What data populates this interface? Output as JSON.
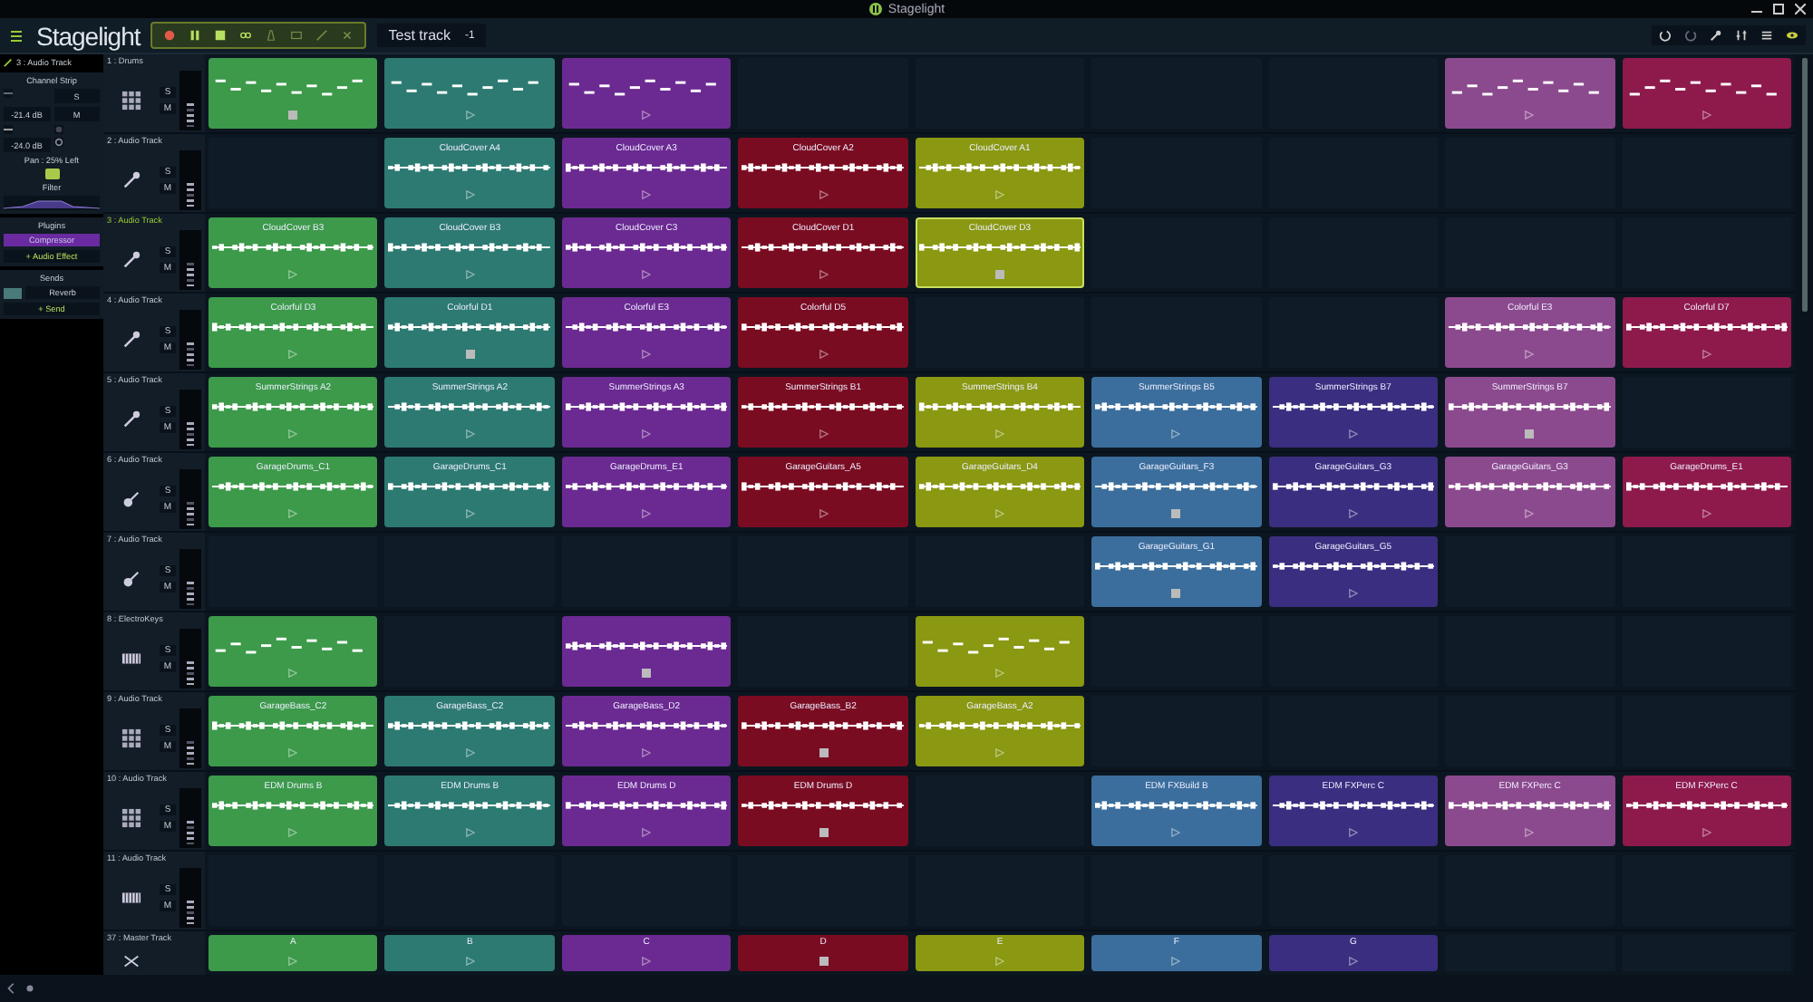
{
  "title_bar": {
    "title": "Stagelight"
  },
  "toolbar": {
    "logo": "Stagelight",
    "project_name": "Test track",
    "transpose": "-1"
  },
  "inspector": {
    "track_label": "3 : Audio Track",
    "channel_strip_title": "Channel Strip",
    "solo": "S",
    "mute": "M",
    "volume": "-21.4 dB",
    "peak": "-24.0 dB",
    "pan": "Pan : 25% Left",
    "filter_title": "Filter",
    "plugins_title": "Plugins",
    "plugins": [
      {
        "name": "Compressor",
        "selected": true
      }
    ],
    "add_effect": "+ Audio Effect",
    "sends_title": "Sends",
    "sends": [
      {
        "name": "Reverb"
      }
    ],
    "add_send": "+ Send"
  },
  "tracks": [
    {
      "label": "1 : Drums",
      "kind": "pads",
      "selected": false,
      "solo": "S",
      "mute": "M",
      "clips": [
        {
          "kind": "midi",
          "color": "#3c9a4a",
          "playing": true,
          "selected": false
        },
        {
          "kind": "midi",
          "color": "#2d7a72",
          "playing": false,
          "selected": false
        },
        {
          "kind": "midi",
          "color": "#6b2a91",
          "playing": false,
          "selected": false
        },
        {
          "kind": "empty"
        },
        {
          "kind": "empty"
        },
        {
          "kind": "empty"
        },
        {
          "kind": "empty"
        },
        {
          "kind": "midi",
          "color": "#8c4a8e",
          "playing": false,
          "selected": false
        },
        {
          "kind": "midi",
          "color": "#8e1a4c",
          "playing": false,
          "selected": false
        }
      ]
    },
    {
      "label": "2 : Audio Track",
      "kind": "mic",
      "selected": false,
      "solo": "S",
      "mute": "M",
      "clips": [
        {
          "kind": "empty"
        },
        {
          "kind": "audio",
          "name": "CloudCover A4",
          "color": "#2d7a72",
          "playing": false,
          "selected": false
        },
        {
          "kind": "audio",
          "name": "CloudCover A3",
          "color": "#6b2a91",
          "playing": false,
          "selected": false
        },
        {
          "kind": "audio",
          "name": "CloudCover A2",
          "color": "#7a0c22",
          "playing": false,
          "selected": false
        },
        {
          "kind": "audio",
          "name": "CloudCover A1",
          "color": "#8a9812",
          "playing": false,
          "selected": false
        },
        {
          "kind": "empty"
        },
        {
          "kind": "empty"
        },
        {
          "kind": "empty"
        },
        {
          "kind": "empty"
        }
      ]
    },
    {
      "label": "3 : Audio Track",
      "kind": "mic",
      "selected": true,
      "solo": "S",
      "mute": "M",
      "clips": [
        {
          "kind": "audio",
          "name": "CloudCover B3",
          "color": "#3c9a4a",
          "playing": false,
          "selected": false
        },
        {
          "kind": "audio",
          "name": "CloudCover B3",
          "color": "#2d7a72",
          "playing": false,
          "selected": false
        },
        {
          "kind": "audio",
          "name": "CloudCover C3",
          "color": "#6b2a91",
          "playing": false,
          "selected": false
        },
        {
          "kind": "audio",
          "name": "CloudCover D1",
          "color": "#7a0c22",
          "playing": false,
          "selected": false
        },
        {
          "kind": "audio",
          "name": "CloudCover D3",
          "color": "#8a9812",
          "playing": true,
          "selected": true
        },
        {
          "kind": "empty"
        },
        {
          "kind": "empty"
        },
        {
          "kind": "empty"
        },
        {
          "kind": "empty"
        }
      ]
    },
    {
      "label": "4 : Audio Track",
      "kind": "mic",
      "selected": false,
      "solo": "S",
      "mute": "M",
      "clips": [
        {
          "kind": "audio",
          "name": "Colorful D3",
          "color": "#3c9a4a",
          "playing": false,
          "selected": false
        },
        {
          "kind": "audio",
          "name": "Colorful D1",
          "color": "#2d7a72",
          "playing": true,
          "selected": false
        },
        {
          "kind": "audio",
          "name": "Colorful E3",
          "color": "#6b2a91",
          "playing": false,
          "selected": false
        },
        {
          "kind": "audio",
          "name": "Colorful D5",
          "color": "#7a0c22",
          "playing": false,
          "selected": false
        },
        {
          "kind": "empty"
        },
        {
          "kind": "empty"
        },
        {
          "kind": "empty"
        },
        {
          "kind": "audio",
          "name": "Colorful E3",
          "color": "#8c4a8e",
          "playing": false,
          "selected": false
        },
        {
          "kind": "audio",
          "name": "Colorful D7",
          "color": "#8e1a4c",
          "playing": false,
          "selected": false
        }
      ]
    },
    {
      "label": "5 : Audio Track",
      "kind": "mic",
      "selected": false,
      "solo": "S",
      "mute": "M",
      "clips": [
        {
          "kind": "audio",
          "name": "SummerStrings A2",
          "color": "#3c9a4a",
          "playing": false,
          "selected": false
        },
        {
          "kind": "audio",
          "name": "SummerStrings A2",
          "color": "#2d7a72",
          "playing": false,
          "selected": false
        },
        {
          "kind": "audio",
          "name": "SummerStrings A3",
          "color": "#6b2a91",
          "playing": false,
          "selected": false
        },
        {
          "kind": "audio",
          "name": "SummerStrings B1",
          "color": "#7a0c22",
          "playing": false,
          "selected": false
        },
        {
          "kind": "audio",
          "name": "SummerStrings B4",
          "color": "#8a9812",
          "playing": false,
          "selected": false
        },
        {
          "kind": "audio",
          "name": "SummerStrings B5",
          "color": "#3b6e9c",
          "playing": false,
          "selected": false
        },
        {
          "kind": "audio",
          "name": "SummerStrings B7",
          "color": "#3a2e80",
          "playing": false,
          "selected": false
        },
        {
          "kind": "audio",
          "name": "SummerStrings B7",
          "color": "#8c4a8e",
          "playing": true,
          "selected": false
        },
        {
          "kind": "empty"
        }
      ]
    },
    {
      "label": "6 : Audio Track",
      "kind": "guitar",
      "selected": false,
      "solo": "S",
      "mute": "M",
      "clips": [
        {
          "kind": "audio",
          "name": "GarageDrums_C1",
          "color": "#3c9a4a",
          "playing": false,
          "selected": false
        },
        {
          "kind": "audio",
          "name": "GarageDrums_C1",
          "color": "#2d7a72",
          "playing": false,
          "selected": false
        },
        {
          "kind": "audio",
          "name": "GarageDrums_E1",
          "color": "#6b2a91",
          "playing": false,
          "selected": false
        },
        {
          "kind": "audio",
          "name": "GarageGuitars_A5",
          "color": "#7a0c22",
          "playing": false,
          "selected": false
        },
        {
          "kind": "audio",
          "name": "GarageGuitars_D4",
          "color": "#8a9812",
          "playing": false,
          "selected": false
        },
        {
          "kind": "audio",
          "name": "GarageGuitars_F3",
          "color": "#3b6e9c",
          "playing": true,
          "selected": false
        },
        {
          "kind": "audio",
          "name": "GarageGuitars_G3",
          "color": "#3a2e80",
          "playing": false,
          "selected": false
        },
        {
          "kind": "audio",
          "name": "GarageGuitars_G3",
          "color": "#8c4a8e",
          "playing": false,
          "selected": false
        },
        {
          "kind": "audio",
          "name": "GarageDrums_E1",
          "color": "#8e1a4c",
          "playing": false,
          "selected": false
        }
      ]
    },
    {
      "label": "7 : Audio Track",
      "kind": "guitar",
      "selected": false,
      "solo": "S",
      "mute": "M",
      "clips": [
        {
          "kind": "empty"
        },
        {
          "kind": "empty"
        },
        {
          "kind": "empty"
        },
        {
          "kind": "empty"
        },
        {
          "kind": "empty"
        },
        {
          "kind": "audio",
          "name": "GarageGuitars_G1",
          "color": "#3b6e9c",
          "playing": true,
          "selected": false
        },
        {
          "kind": "audio",
          "name": "GarageGuitars_G5",
          "color": "#3a2e80",
          "playing": false,
          "selected": false
        },
        {
          "kind": "empty"
        },
        {
          "kind": "empty"
        }
      ]
    },
    {
      "label": "8 : ElectroKeys",
      "kind": "keys",
      "selected": false,
      "solo": "S",
      "mute": "M",
      "clips": [
        {
          "kind": "midi",
          "color": "#3c9a4a",
          "playing": false,
          "selected": false
        },
        {
          "kind": "empty"
        },
        {
          "kind": "audio",
          "color": "#6b2a91",
          "playing": true,
          "selected": false
        },
        {
          "kind": "empty"
        },
        {
          "kind": "midi",
          "color": "#8a9812",
          "playing": false,
          "selected": false
        },
        {
          "kind": "empty"
        },
        {
          "kind": "empty"
        },
        {
          "kind": "empty"
        },
        {
          "kind": "empty"
        }
      ]
    },
    {
      "label": "9 : Audio Track",
      "kind": "pads",
      "selected": false,
      "solo": "S",
      "mute": "M",
      "clips": [
        {
          "kind": "audio",
          "name": "GarageBass_C2",
          "color": "#3c9a4a",
          "playing": false,
          "selected": false
        },
        {
          "kind": "audio",
          "name": "GarageBass_C2",
          "color": "#2d7a72",
          "playing": false,
          "selected": false
        },
        {
          "kind": "audio",
          "name": "GarageBass_D2",
          "color": "#6b2a91",
          "playing": false,
          "selected": false
        },
        {
          "kind": "audio",
          "name": "GarageBass_B2",
          "color": "#7a0c22",
          "playing": true,
          "selected": false
        },
        {
          "kind": "audio",
          "name": "GarageBass_A2",
          "color": "#8a9812",
          "playing": false,
          "selected": false
        },
        {
          "kind": "empty"
        },
        {
          "kind": "empty"
        },
        {
          "kind": "empty"
        },
        {
          "kind": "empty"
        }
      ]
    },
    {
      "label": "10 : Audio Track",
      "kind": "pads",
      "selected": false,
      "solo": "S",
      "mute": "M",
      "clips": [
        {
          "kind": "audio",
          "name": "EDM Drums B",
          "color": "#3c9a4a",
          "playing": false,
          "selected": false
        },
        {
          "kind": "audio",
          "name": "EDM Drums B",
          "color": "#2d7a72",
          "playing": false,
          "selected": false
        },
        {
          "kind": "audio",
          "name": "EDM Drums D",
          "color": "#6b2a91",
          "playing": false,
          "selected": false
        },
        {
          "kind": "audio",
          "name": "EDM Drums D",
          "color": "#7a0c22",
          "playing": true,
          "selected": false
        },
        {
          "kind": "empty"
        },
        {
          "kind": "audio",
          "name": "EDM FXBuild B",
          "color": "#3b6e9c",
          "playing": false,
          "selected": false
        },
        {
          "kind": "audio",
          "name": "EDM FXPerc C",
          "color": "#3a2e80",
          "playing": false,
          "selected": false
        },
        {
          "kind": "audio",
          "name": "EDM FXPerc C",
          "color": "#8c4a8e",
          "playing": false,
          "selected": false
        },
        {
          "kind": "audio",
          "name": "EDM FXPerc C",
          "color": "#8e1a4c",
          "playing": false,
          "selected": false
        }
      ]
    },
    {
      "label": "11 : Audio Track",
      "kind": "keys",
      "selected": false,
      "solo": "S",
      "mute": "M",
      "clips": [
        {
          "kind": "empty"
        },
        {
          "kind": "empty"
        },
        {
          "kind": "empty"
        },
        {
          "kind": "empty"
        },
        {
          "kind": "empty"
        },
        {
          "kind": "empty"
        },
        {
          "kind": "empty"
        },
        {
          "kind": "empty"
        },
        {
          "kind": "empty"
        }
      ]
    }
  ],
  "master": {
    "label": "37 : Master Track",
    "scenes": [
      {
        "name": "A",
        "color": "#3c9a4a",
        "playing": false
      },
      {
        "name": "B",
        "color": "#2d7a72",
        "playing": false
      },
      {
        "name": "C",
        "color": "#6b2a91",
        "playing": false
      },
      {
        "name": "D",
        "color": "#7a0c22",
        "playing": true
      },
      {
        "name": "E",
        "color": "#8a9812",
        "playing": false
      },
      {
        "name": "F",
        "color": "#3b6e9c",
        "playing": false
      },
      {
        "name": "G",
        "color": "#3a2e80",
        "playing": false
      }
    ]
  }
}
